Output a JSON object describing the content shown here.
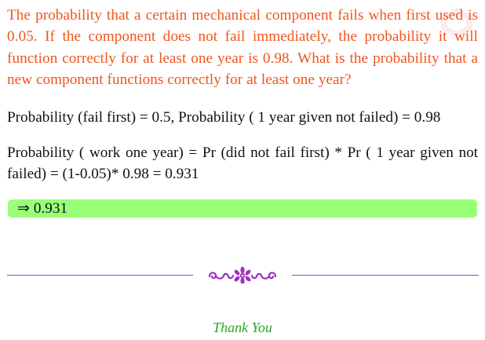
{
  "question": {
    "text": "The probability that a certain mechanical component fails when first used is 0.05. If the component does not fail immediately, the probability it will function correctly for at least one year is 0.98. What is the probability that a new component functions correctly for at least one year?"
  },
  "solution": {
    "given_line": "Probability (fail first) = 0.5, Probability ( 1 year given not failed) = 0.98",
    "calc_line": "Probability ( work one year) = Pr (did not fail first) * Pr ( 1 year given not failed) = (1-0.05)* 0.98 = 0.931"
  },
  "answer": {
    "text": "⇒ 0.931"
  },
  "footer": {
    "thanks": "Thank You"
  },
  "colors": {
    "question": "#f0551e",
    "answer_bg": "#99ff77",
    "divider": "#a040c0",
    "thanks": "#22a822"
  },
  "icons": {
    "ornament": "floral-divider-ornament",
    "watermark": "faint-corner-logo"
  }
}
